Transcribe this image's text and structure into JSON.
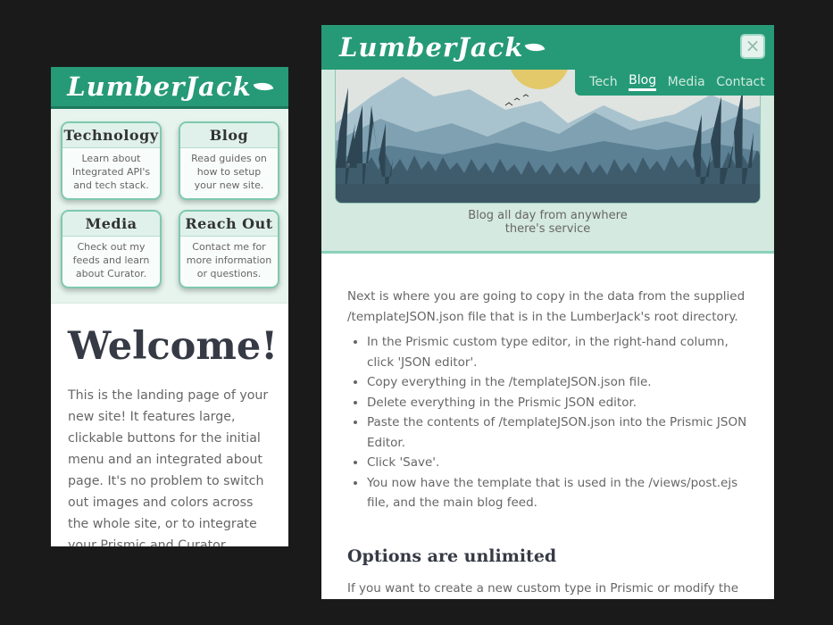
{
  "brand": {
    "name": "LumberJack"
  },
  "phone": {
    "menu": [
      {
        "title": "Technology",
        "desc": "Learn about Integrated API's and tech stack."
      },
      {
        "title": "Blog",
        "desc": "Read guides on how to setup your new site."
      },
      {
        "title": "Media",
        "desc": "Check out my feeds and learn about Curator."
      },
      {
        "title": "Reach Out",
        "desc": "Contact me for more information or questions."
      }
    ],
    "heading": "Welcome!",
    "paragraph": "This is the landing page of your new site! It features large, clickable buttons for the initial menu and an integrated about page. It's no problem to switch out images and colors across the whole site, or to integrate your Prismic and Curator accounts. LumberJack uses"
  },
  "window": {
    "close_label": "×",
    "nav": [
      "Tech",
      "Blog",
      "Media",
      "Contact"
    ],
    "active_nav": "Blog",
    "caption_line1": "Blog all day from anywhere",
    "caption_line2": "there's service",
    "intro": "Next is where you are going to copy in the data from the supplied /templateJSON.json file that is in the LumberJack's root directory.",
    "steps": [
      "In the Prismic custom type editor, in the right-hand column, click 'JSON editor'.",
      "Copy everything in the /templateJSON.json file.",
      "Delete everything in the Prismic JSON editor.",
      "Paste the contents of /templateJSON.json into the Prismic JSON Editor.",
      "Click 'Save'.",
      "You now have the template that is used in the /views/post.ejs file, and the main blog feed."
    ],
    "section_title": "Options are unlimited",
    "section_text": "If you want to create a new custom type in Prismic or modify the supplied"
  },
  "colors": {
    "brand_green": "#269a76",
    "hero_bg": "#d4e9e0",
    "card_border": "#7fc9b0"
  }
}
